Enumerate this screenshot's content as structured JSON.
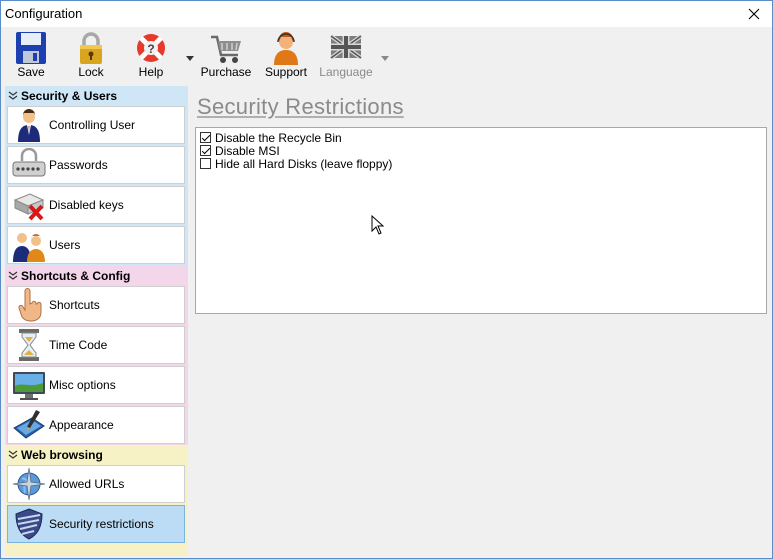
{
  "window": {
    "title": "Configuration"
  },
  "toolbar": {
    "buttons": [
      {
        "label": "Save",
        "icon": "save-disk-icon"
      },
      {
        "label": "Lock",
        "icon": "padlock-icon"
      },
      {
        "label": "Help",
        "icon": "lifebuoy-icon"
      },
      {
        "label": "Purchase",
        "icon": "shopping-cart-icon"
      },
      {
        "label": "Support",
        "icon": "support-agent-icon"
      },
      {
        "label": "Language",
        "icon": "uk-flag-icon",
        "disabled": true
      }
    ]
  },
  "sidebar": {
    "groups": [
      {
        "title": "Security & Users",
        "color": "#cfe6f7",
        "items": [
          {
            "label": "Controlling User",
            "icon": "user-icon"
          },
          {
            "label": "Passwords",
            "icon": "password-keyboard-icon"
          },
          {
            "label": "Disabled keys",
            "icon": "disabled-keys-icon"
          },
          {
            "label": "Users",
            "icon": "users-icon"
          }
        ]
      },
      {
        "title": "Shortcuts & Config",
        "color": "#f4d6ea",
        "items": [
          {
            "label": "Shortcuts",
            "icon": "pointing-hand-icon"
          },
          {
            "label": "Time Code",
            "icon": "hourglass-icon"
          },
          {
            "label": "Misc options",
            "icon": "monitor-icon"
          },
          {
            "label": "Appearance",
            "icon": "paint-laptop-icon"
          }
        ]
      },
      {
        "title": "Web browsing",
        "color": "#f6f2c6",
        "items": [
          {
            "label": "Allowed URLs",
            "icon": "globe-compass-icon"
          },
          {
            "label": "Security restrictions",
            "icon": "shield-icon",
            "active": true
          }
        ]
      }
    ]
  },
  "main": {
    "title": "Security Restrictions",
    "options": [
      {
        "label": "Disable the Recycle Bin",
        "checked": true
      },
      {
        "label": "Disable MSI",
        "checked": true
      },
      {
        "label": "Hide all Hard Disks (leave floppy)",
        "checked": false
      }
    ]
  }
}
